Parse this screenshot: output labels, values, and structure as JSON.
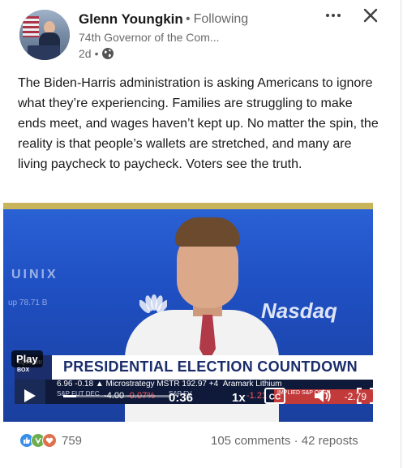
{
  "author": {
    "name": "Glenn Youngkin",
    "follow_status": "Following",
    "headline": "74th Governor of the Com...",
    "age": "2d",
    "visibility_icon": "globe-icon"
  },
  "post": {
    "text": "The Biden-Harris administration is asking Americans to ignore what they’re experiencing. Families are struggling to make ends meet, and wages haven’t kept up. No matter the spin, the reality is that people’s wallets are stretched, and many are living paycheck to paycheck. Voters see the truth."
  },
  "video": {
    "background_text": "UINIX",
    "background_number": "up 78.71 B",
    "brand_text": "Nasdaq",
    "play_label": "Play",
    "show_tag": "SQUAWK BOX",
    "headline": "PRESIDENTIAL ELECTION COUNTDOWN",
    "ticker": {
      "items_text": "6.96 -0.18 ▲  Microstrategy  MSTR 192.97 +4",
      "trailing_text": "Aramark  Lithium",
      "sp_fut_label": "S&P FUT DEC",
      "sp_fut_value": "-4.00",
      "sp_fut_pct": "-0.07%",
      "sp_fv_label": "S&P FV",
      "sp_fv_value": "-1.21",
      "implied_label": "IMPLIED S&P OPEN",
      "implied_value": "-2.79"
    },
    "controls": {
      "time": "0:36",
      "speed": "1x",
      "progress": 0.12,
      "cc_label": "CC"
    }
  },
  "footer": {
    "reaction_count": "759",
    "comments": "105 comments",
    "separator": "·",
    "reposts": "42 reposts"
  },
  "colors": {
    "like_blue": "#378fe9",
    "celebrate_green": "#6dae4f",
    "love_red": "#df704d"
  }
}
